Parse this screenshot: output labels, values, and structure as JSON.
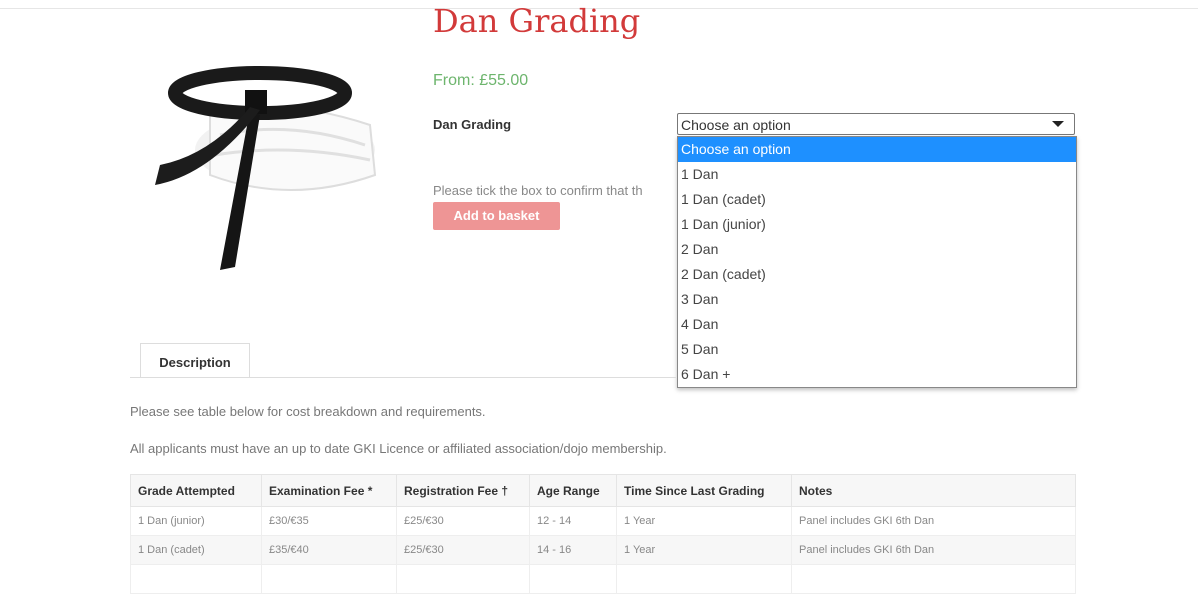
{
  "product": {
    "title": "Dan Grading",
    "price": "From: £55.00",
    "variant_label": "Dan Grading",
    "confirm_text": "Please tick the box to confirm that th",
    "add_to_basket": "Add to basket"
  },
  "select": {
    "value": "Choose an option",
    "options": [
      "Choose an option",
      "1 Dan",
      "1 Dan (cadet)",
      "1 Dan (junior)",
      "2 Dan",
      "2 Dan (cadet)",
      "3 Dan",
      "4 Dan",
      "5 Dan",
      "6 Dan +"
    ]
  },
  "tabs": {
    "description": "Description"
  },
  "description": {
    "line1": "Please see table below for cost breakdown and requirements.",
    "line2": "All applicants must have an up to date GKI Licence or affiliated association/dojo membership."
  },
  "table": {
    "headers": [
      "Grade Attempted",
      "Examination Fee *",
      "Registration Fee †",
      "Age Range",
      "Time Since Last Grading",
      "Notes"
    ],
    "rows": [
      [
        "1 Dan (junior)",
        "£30/€35",
        "£25/€30",
        "12 - 14",
        "1 Year",
        "Panel includes GKI 6th Dan"
      ],
      [
        "1 Dan (cadet)",
        "£35/€40",
        "£25/€30",
        "14 - 16",
        "1 Year",
        "Panel includes GKI 6th Dan"
      ]
    ]
  },
  "colors": {
    "title": "#d23a3a",
    "price": "#6db56d",
    "button": "#ee9595",
    "selected_option": "#1e90ff"
  }
}
